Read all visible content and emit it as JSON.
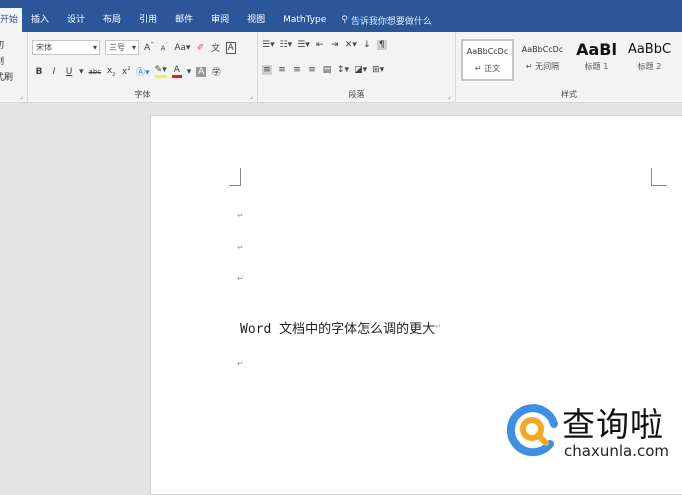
{
  "tabs": [
    {
      "label": "开始",
      "active": true
    },
    {
      "label": "插入"
    },
    {
      "label": "设计"
    },
    {
      "label": "布局"
    },
    {
      "label": "引用"
    },
    {
      "label": "邮件"
    },
    {
      "label": "审阅"
    },
    {
      "label": "视图"
    },
    {
      "label": "MathType"
    }
  ],
  "search_placeholder": "告诉我你想要做什么",
  "clipboard": {
    "cut": "剪切",
    "copy": "复制",
    "format_painter": "格式刷"
  },
  "font": {
    "name": "宋体",
    "size": "三号",
    "group_label": "字体"
  },
  "paragraph": {
    "group_label": "段落"
  },
  "styles": {
    "group_label": "样式",
    "items": [
      {
        "preview": "AaBbCcDc",
        "name": "↵ 正文",
        "selected": true
      },
      {
        "preview": "AaBbCcDc",
        "name": "↵ 无间隔"
      },
      {
        "preview": "AaBl",
        "name": "标题 1"
      },
      {
        "preview": "AaBbC",
        "name": "标题 2"
      }
    ]
  },
  "document": {
    "line": "Word 文档中的字体怎么调的更大",
    "para_mark": "↵"
  },
  "watermark": {
    "brand": "查询啦",
    "url": "chaxunla.com"
  },
  "colors": {
    "accent": "#2b579a",
    "logo_blue": "#3d8fe6",
    "logo_orange": "#f5a623"
  }
}
